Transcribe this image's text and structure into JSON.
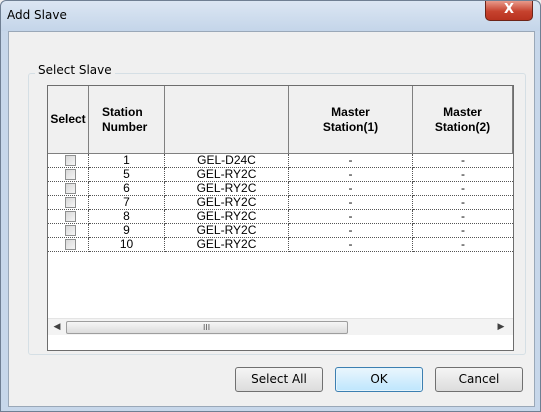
{
  "window": {
    "title": "Add Slave",
    "close_glyph": "X"
  },
  "group": {
    "label": "Select Slave"
  },
  "grid": {
    "columns": [
      "Select",
      "Station\nNumber",
      "",
      "Master\nStation(1)",
      "Master\nStation(2)"
    ],
    "rows": [
      {
        "checked": false,
        "station": "1",
        "model": "GEL-D24C",
        "master1": "-",
        "master2": "-"
      },
      {
        "checked": false,
        "station": "5",
        "model": "GEL-RY2C",
        "master1": "-",
        "master2": "-"
      },
      {
        "checked": false,
        "station": "6",
        "model": "GEL-RY2C",
        "master1": "-",
        "master2": "-"
      },
      {
        "checked": false,
        "station": "7",
        "model": "GEL-RY2C",
        "master1": "-",
        "master2": "-"
      },
      {
        "checked": false,
        "station": "8",
        "model": "GEL-RY2C",
        "master1": "-",
        "master2": "-"
      },
      {
        "checked": false,
        "station": "9",
        "model": "GEL-RY2C",
        "master1": "-",
        "master2": "-"
      },
      {
        "checked": false,
        "station": "10",
        "model": "GEL-RY2C",
        "master1": "-",
        "master2": "-"
      }
    ],
    "scrollbar": {
      "left_arrow": "◀",
      "right_arrow": "▶",
      "grip": "III"
    }
  },
  "buttons": {
    "select_all": "Select All",
    "ok": "OK",
    "cancel": "Cancel"
  }
}
